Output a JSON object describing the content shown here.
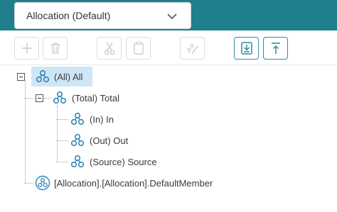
{
  "header": {
    "dimension_select": {
      "value": "Allocation (Default)",
      "icon": "chevron-down-icon"
    }
  },
  "toolbar": {
    "buttons": [
      {
        "name": "add",
        "icon": "plus-icon",
        "enabled": false
      },
      {
        "name": "delete",
        "icon": "trash-icon",
        "enabled": false
      },
      {
        "name": "cut",
        "icon": "scissors-icon",
        "enabled": false
      },
      {
        "name": "paste",
        "icon": "clipboard-icon",
        "enabled": false
      },
      {
        "name": "edit-formula",
        "icon": "formula-edit-icon",
        "enabled": false
      },
      {
        "name": "import",
        "icon": "import-icon",
        "enabled": true
      },
      {
        "name": "export",
        "icon": "export-icon",
        "enabled": true
      }
    ]
  },
  "tree": {
    "nodes": [
      {
        "label": "(All) All",
        "level": 0,
        "expanded": true,
        "selected": true,
        "icon": "hierarchy-icon"
      },
      {
        "label": "(Total) Total",
        "level": 1,
        "expanded": true,
        "selected": false,
        "icon": "hierarchy-icon"
      },
      {
        "label": "(In) In",
        "level": 2,
        "selected": false,
        "icon": "hierarchy-icon"
      },
      {
        "label": "(Out) Out",
        "level": 2,
        "selected": false,
        "icon": "hierarchy-icon"
      },
      {
        "label": "(Source) Source",
        "level": 2,
        "selected": false,
        "icon": "hierarchy-icon"
      },
      {
        "label": "[Allocation].[Allocation].DefaultMember",
        "level": 0,
        "selected": false,
        "icon": "default-member-icon"
      }
    ]
  },
  "colors": {
    "header": "#1f7f8c",
    "accent": "#2e8ea0",
    "selection": "#cfe6f7",
    "icon": "#2f86b8"
  }
}
